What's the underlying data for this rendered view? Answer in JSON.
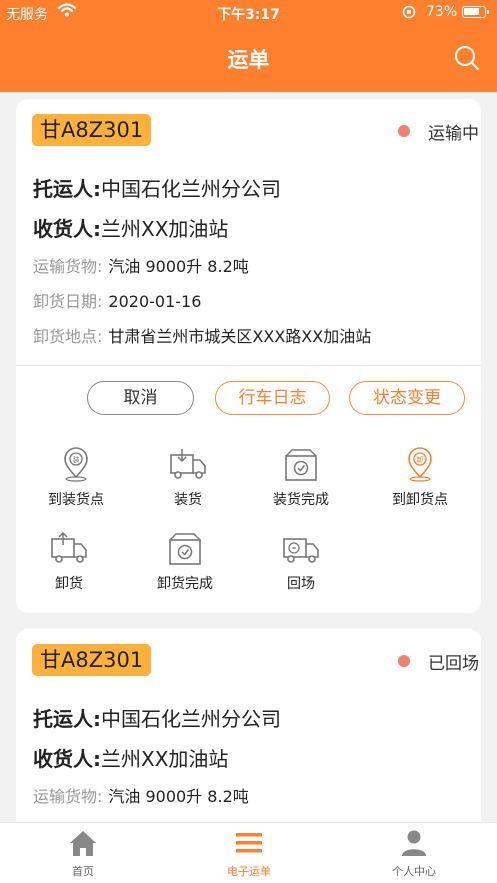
{
  "status_bar": {
    "carrier": "无服务",
    "time": "下午3:17",
    "battery": "73%"
  },
  "header": {
    "title": "运单"
  },
  "colors": {
    "primary": "#fe7f2d",
    "plate_bg": "#fdb13d",
    "status_dot": "#f08070"
  },
  "labels": {
    "shipper": "托运人:",
    "consignee": "收货人:",
    "cargo": "运输货物:",
    "unload_date": "卸货日期:",
    "unload_place": "卸货地点:"
  },
  "orders": [
    {
      "plate": "甘A8Z301",
      "status": "运输中",
      "shipper": "中国石化兰州分公司",
      "consignee": "兰州XX加油站",
      "cargo": "汽油 9000升  8.2吨",
      "unload_date": "2020-01-16",
      "unload_place": "甘肃省兰州市城关区XXX路XX加油站",
      "buttons": {
        "cancel": "取消",
        "log": "行车日志",
        "change": "状态变更"
      },
      "steps": [
        {
          "label": "到装货点",
          "icon": "pin-load-icon"
        },
        {
          "label": "装货",
          "icon": "truck-load-icon"
        },
        {
          "label": "装货完成",
          "icon": "box-check-icon"
        },
        {
          "label": "到卸货点",
          "icon": "pin-unload-icon"
        },
        {
          "label": "卸货",
          "icon": "truck-unload-icon"
        },
        {
          "label": "卸货完成",
          "icon": "box-check-icon"
        },
        {
          "label": "回场",
          "icon": "truck-return-icon"
        }
      ]
    },
    {
      "plate": "甘A8Z301",
      "status": "已回场",
      "shipper": "中国石化兰州分公司",
      "consignee": "兰州XX加油站",
      "cargo": "汽油 9000升  8.2吨"
    }
  ],
  "tabs": [
    {
      "label": "首页",
      "icon": "home-icon"
    },
    {
      "label": "电子运单",
      "icon": "list-icon"
    },
    {
      "label": "个人中心",
      "icon": "person-icon"
    }
  ]
}
